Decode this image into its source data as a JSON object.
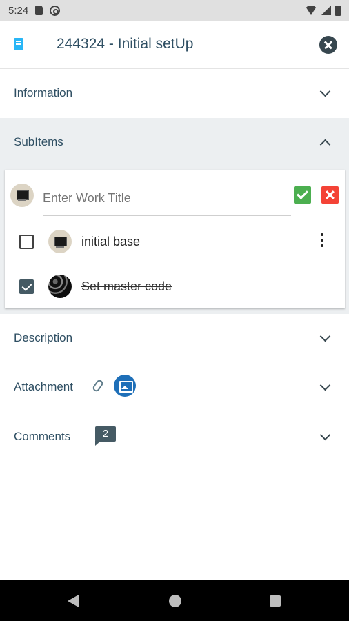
{
  "status_bar": {
    "time": "5:24"
  },
  "header": {
    "title": "244324 - Initial setUp"
  },
  "sections": {
    "information": "Information",
    "subitems": "SubItems",
    "description": "Description",
    "attachment": "Attachment",
    "comments": "Comments"
  },
  "subitems": {
    "input": {
      "placeholder": "Enter Work Title",
      "value": ""
    },
    "items": [
      {
        "label": "initial base",
        "checked": false
      },
      {
        "label": "Set master code",
        "checked": true
      }
    ]
  },
  "comments_count": "2",
  "colors": {
    "accent": "#2f4f63",
    "confirm": "#4caf50",
    "cancel": "#f44336",
    "image_badge": "#1e6fb8"
  }
}
